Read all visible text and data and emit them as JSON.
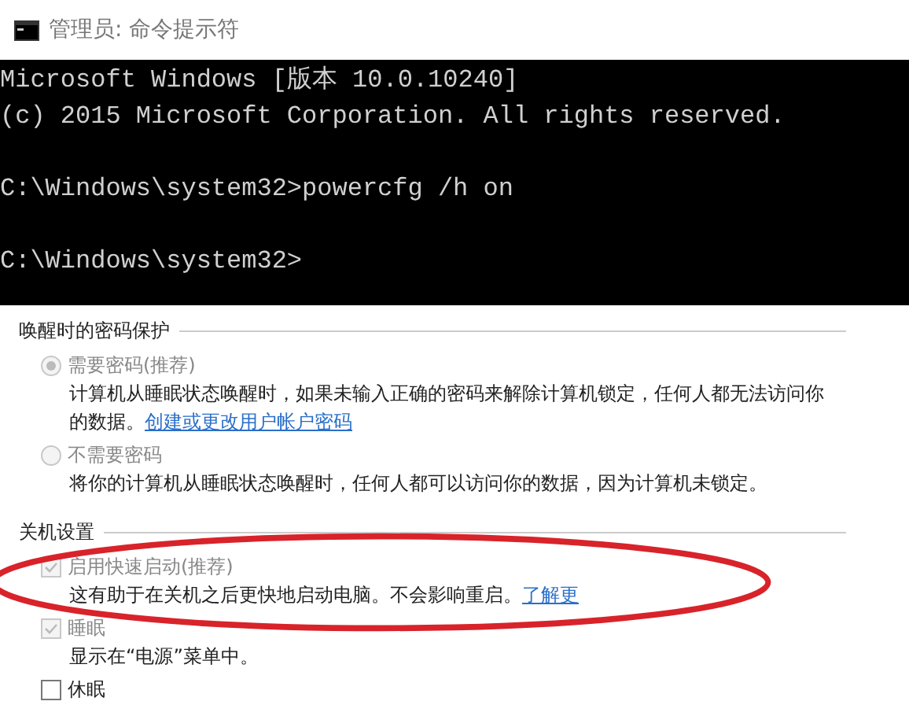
{
  "window": {
    "title": "管理员: 命令提示符"
  },
  "console": {
    "blocks": [
      [
        "Microsoft Windows [版本 10.0.10240]",
        "(c) 2015 Microsoft Corporation. All rights reserved."
      ],
      [
        "C:\\Windows\\system32>powercfg /h on"
      ],
      [
        "C:\\Windows\\system32>"
      ]
    ]
  },
  "settings": {
    "sections": [
      {
        "title": "唤醒时的密码保护",
        "options": [
          {
            "kind": "radio",
            "label": "需要密码(推荐)",
            "selected": true,
            "disabled": true,
            "highlighted": false,
            "description": "计算机从睡眠状态唤醒时，如果未输入正确的密码来解除计算机锁定，任何人都无法访问你的数据。",
            "link": "创建或更改用户帐户密码"
          },
          {
            "kind": "radio",
            "label": "不需要密码",
            "selected": false,
            "disabled": true,
            "highlighted": false,
            "description": "将你的计算机从睡眠状态唤醒时，任何人都可以访问你的数据，因为计算机未锁定。"
          }
        ]
      },
      {
        "title": "关机设置",
        "options": [
          {
            "kind": "checkbox",
            "label": "启用快速启动(推荐)",
            "checked": true,
            "disabled": true,
            "highlighted": true,
            "description": "这有助于在关机之后更快地启动电脑。不会影响重启。",
            "link": "了解更"
          },
          {
            "kind": "checkbox",
            "label": "睡眠",
            "checked": true,
            "disabled": true,
            "highlighted": false,
            "description": "显示在“电源”菜单中。"
          },
          {
            "kind": "checkbox",
            "label": "休眠",
            "checked": false,
            "disabled": false,
            "highlighted": false
          }
        ]
      }
    ]
  }
}
